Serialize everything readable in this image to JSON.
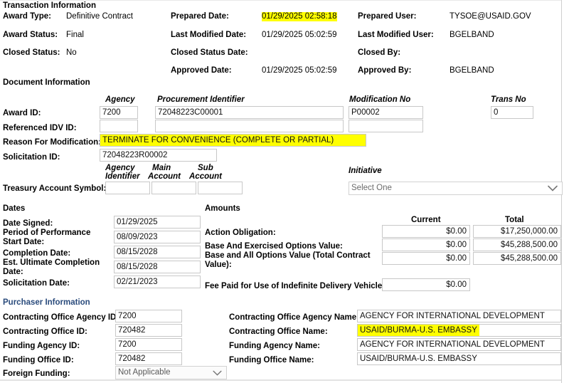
{
  "sections": {
    "transaction": "Transaction Information",
    "document": "Document Information",
    "dates": "Dates",
    "amounts": "Amounts",
    "purchaser": "Purchaser Information"
  },
  "transaction": {
    "left": [
      {
        "label": "Award Type:",
        "value": "Definitive Contract"
      },
      {
        "label": "Award Status:",
        "value": "Final"
      },
      {
        "label": "Closed Status:",
        "value": "No"
      }
    ],
    "mid": [
      {
        "label": "Prepared Date:",
        "value": "01/29/2025 02:58:18",
        "highlight": true
      },
      {
        "label": "Last Modified Date:",
        "value": "01/29/2025 05:02:59",
        "highlight": false
      },
      {
        "label": "Closed Status Date:",
        "value": "",
        "highlight": false
      },
      {
        "label": "Approved Date:",
        "value": "01/29/2025 05:02:59",
        "highlight": false
      }
    ],
    "right": [
      {
        "label": "Prepared User:",
        "value": "TYSOE@USAID.GOV"
      },
      {
        "label": "Last Modified User:",
        "value": "BGELBAND"
      },
      {
        "label": "Closed By:",
        "value": ""
      },
      {
        "label": "Approved By:",
        "value": "BGELBAND"
      }
    ]
  },
  "document": {
    "col_headers": {
      "agency": "Agency",
      "procurement_identifier": "Procurement Identifier",
      "modification_no": "Modification No",
      "trans_no": "Trans No"
    },
    "labels": {
      "award_id": "Award ID:",
      "referenced_idv_id": "Referenced IDV ID:",
      "reason_for_modification": "Reason For Modification:",
      "solicitation_id": "Solicitation ID:",
      "treasury_account_symbol": "Treasury Account Symbol:"
    },
    "award_id": {
      "agency": "7200",
      "procurement_identifier": "72048223C00001",
      "modification_no": "P00002",
      "trans_no": "0"
    },
    "referenced_idv_id": {
      "agency": "",
      "procurement_identifier": "",
      "modification_no": ""
    },
    "reason_for_modification": "TERMINATE FOR CONVENIENCE (COMPLETE OR PARTIAL)",
    "solicitation_id": "72048223R00002",
    "tas_headers": {
      "agency_identifier_l1": "Agency",
      "agency_identifier_l2": "Identifier",
      "main_account_l1": "Main",
      "main_account_l2": "Account",
      "sub_account_l1": "Sub",
      "sub_account_l2": "Account"
    },
    "tas": {
      "agency_identifier": "",
      "main_account": "",
      "sub_account": ""
    },
    "initiative": {
      "label": "Initiative",
      "selected": "Select One",
      "options": [
        "Select One"
      ]
    }
  },
  "dates": [
    {
      "label": "Date Signed:",
      "value": "01/29/2025"
    },
    {
      "label": "Period of Performance Start Date:",
      "value": "08/09/2023"
    },
    {
      "label": "Completion Date:",
      "value": "08/15/2028"
    },
    {
      "label": "Est. Ultimate Completion Date:",
      "value": "08/15/2028"
    },
    {
      "label": "Solicitation Date:",
      "value": "02/21/2023"
    }
  ],
  "amounts": {
    "col_current": "Current",
    "col_total": "Total",
    "rows": [
      {
        "label": "Action Obligation:",
        "current": "$0.00",
        "total": "$17,250,000.00"
      },
      {
        "label": "Base And Exercised Options Value:",
        "current": "$0.00",
        "total": "$45,288,500.00"
      },
      {
        "label": "Base and All Options Value (Total Contract Value):",
        "current": "$0.00",
        "total": "$45,288,500.00"
      }
    ],
    "fee": {
      "label": "Fee Paid for Use of Indefinite Delivery Vehicle:",
      "current": "$0.00"
    }
  },
  "purchaser": {
    "left": [
      {
        "label": "Contracting Office Agency ID:",
        "value": "7200",
        "type": "text"
      },
      {
        "label": "Contracting Office ID:",
        "value": "720482",
        "type": "text"
      },
      {
        "label": "Funding Agency ID:",
        "value": "7200",
        "type": "text"
      },
      {
        "label": "Funding Office ID:",
        "value": "720482",
        "type": "text"
      },
      {
        "label": "Foreign Funding:",
        "value": "Not Applicable",
        "type": "select"
      }
    ],
    "right": [
      {
        "label": "Contracting Office Agency Name:",
        "value": "AGENCY FOR INTERNATIONAL DEVELOPMENT",
        "highlight": false
      },
      {
        "label": "Contracting Office Name:",
        "value": "USAID/BURMA-U.S. EMBASSY",
        "highlight": true
      },
      {
        "label": "Funding Agency Name:",
        "value": "AGENCY FOR INTERNATIONAL DEVELOPMENT",
        "highlight": false
      },
      {
        "label": "Funding Office Name:",
        "value": "USAID/BURMA-U.S. EMBASSY",
        "highlight": false
      }
    ]
  },
  "colors": {
    "section_blue": "#2a4b7c",
    "highlight": "#ffff00",
    "box_border": "#c8c8c8"
  }
}
